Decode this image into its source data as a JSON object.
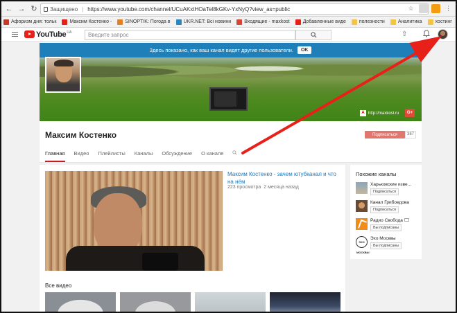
{
  "browser": {
    "secure_label": "Защищено",
    "url": "https://www.youtube.com/channel/UCuAKxtHOaTel8kGKv-YxNyQ?view_as=public",
    "bookmarks": [
      {
        "label": "Афоризм дня: тольк",
        "color": "#c0392b"
      },
      {
        "label": "Максим Костенко -",
        "color": "#e62117"
      },
      {
        "label": "SINOPTIK: Погода в",
        "color": "#e67e22"
      },
      {
        "label": "UKR.NET: Всі новини",
        "color": "#2e86c1"
      },
      {
        "label": "Входящие - maxkost",
        "color": "#d44638"
      },
      {
        "label": "Добавленные виде",
        "color": "#e62117"
      },
      {
        "label": "полезности",
        "color": "#f4c542"
      },
      {
        "label": "Аналитика",
        "color": "#f4c542"
      },
      {
        "label": "хостинг",
        "color": "#f4c542"
      }
    ]
  },
  "youtube": {
    "logo_text": "YouTube",
    "logo_region": "UA",
    "search_placeholder": "Введите запрос"
  },
  "banner": {
    "notice_text": "Здесь показано, как ваш канал видят другие пользователи.",
    "ok_label": "OK",
    "link_text": "http://maxkost.ru",
    "gplus_label": "G+"
  },
  "channel": {
    "name": "Максим Костенко",
    "subscribe_label": "Подписаться",
    "subscriber_count": "387",
    "tabs": [
      "Главная",
      "Видео",
      "Плейлисты",
      "Каналы",
      "Обсуждение",
      "О канале"
    ],
    "active_tab": "Главная"
  },
  "featured": {
    "title": "Максим Костенко - зачем ютубканал и что на нём",
    "views": "223 просмотра",
    "age": "2 месяца назад"
  },
  "all_videos_title": "Все видео",
  "sidebar": {
    "title": "Похожие каналы",
    "channels": [
      {
        "name": "Харьковские изве...",
        "button": "Подписаться"
      },
      {
        "name": "Канал Грибоедова",
        "button": "Подписаться"
      },
      {
        "name": "Радио Свобода",
        "button": "Вы подписаны"
      },
      {
        "name": "Эхо Москвы",
        "button": "Вы подписаны"
      }
    ],
    "echo_logo_text": "ЭХО МОСКВЫ"
  },
  "colors": {
    "youtube_red": "#e62117",
    "notice_blue": "#1e7fb9",
    "link_blue": "#167ac6",
    "arrow_red": "#e8201a"
  }
}
